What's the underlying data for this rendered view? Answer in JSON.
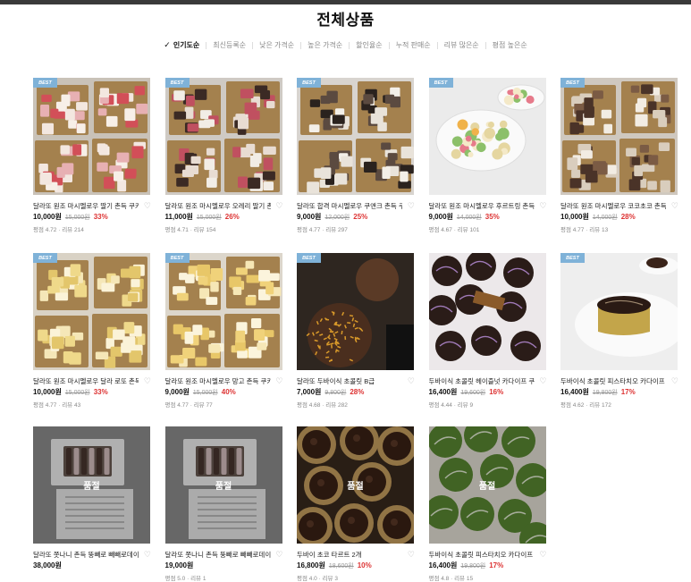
{
  "page_title": "전체상품",
  "sort_options": [
    {
      "label": "인기도순",
      "active": true
    },
    {
      "label": "최신등록순",
      "active": false
    },
    {
      "label": "낮은 가격순",
      "active": false
    },
    {
      "label": "높은 가격순",
      "active": false
    },
    {
      "label": "할인율순",
      "active": false
    },
    {
      "label": "누적 판매순",
      "active": false
    },
    {
      "label": "리뷰 많은순",
      "active": false
    },
    {
      "label": "평점 높은순",
      "active": false
    }
  ],
  "badge_best": "BEST",
  "soldout_label": "품절",
  "products": [
    {
      "name": "달라또 원조 마시멜로우 딸기 촌득 쿠키",
      "price": "10,000원",
      "orig": "15,000원",
      "disc": "33%",
      "rating": "평점 4.72 · 리뷰 214",
      "best": true,
      "img": "box-pink",
      "soldout": false
    },
    {
      "name": "달라또 원조 마시멜로우 오레리 딸기 촌득",
      "price": "11,000원",
      "orig": "15,000원",
      "disc": "26%",
      "rating": "평점 4.71 · 리뷰 154",
      "best": true,
      "img": "box-dark",
      "soldout": false
    },
    {
      "name": "달라또 합격 마시멜로우 쿠앤크 촌득 쿠키",
      "price": "9,000원",
      "orig": "12,000원",
      "disc": "25%",
      "rating": "평점 4.77 · 리뷰 297",
      "best": true,
      "img": "box-cookie",
      "soldout": false
    },
    {
      "name": "달라또 원조 마시멜로우 후르트링 촌득 쿠키",
      "price": "9,000원",
      "orig": "14,000원",
      "disc": "35%",
      "rating": "평점 4.67 · 리뷰 101",
      "best": true,
      "img": "plate",
      "soldout": false
    },
    {
      "name": "달라또 원조 마시멜로우 코코초코 촌득 쿠키",
      "price": "10,000원",
      "orig": "14,000원",
      "disc": "28%",
      "rating": "평점 4.77 · 리뷰 13",
      "best": true,
      "img": "box-coco",
      "soldout": false
    },
    {
      "name": "달라또 원조 마시멜로우 달라 로또 촌득 쿠키",
      "price": "10,000원",
      "orig": "15,000원",
      "disc": "33%",
      "rating": "평점 4.77 · 리뷰 43",
      "best": true,
      "img": "box-yellow",
      "soldout": false
    },
    {
      "name": "달라또 원조 마시멜로우 망고 촌득 쿠키",
      "price": "9,000원",
      "orig": "15,000원",
      "disc": "40%",
      "rating": "평점 4.77 · 리뷰 77",
      "best": true,
      "img": "box-yellow2",
      "soldout": false
    },
    {
      "name": "달라또 두바이식 초콜릿 B급",
      "price": "7,000원",
      "orig": "9,800원",
      "disc": "28%",
      "rating": "평점 4.68 · 리뷰 282",
      "best": true,
      "img": "choco-hand",
      "soldout": false
    },
    {
      "name": "두바이식 초콜릿 헤이즐넛 카다이프 쿠키",
      "price": "16,400원",
      "orig": "19,600원",
      "disc": "16%",
      "rating": "평점 4.44 · 리뷰 9",
      "best": false,
      "img": "choco-balls",
      "soldout": false
    },
    {
      "name": "두바이식 초콜릿 피스타치오 카다이프 쿠키",
      "price": "16,400원",
      "orig": "19,800원",
      "disc": "17%",
      "rating": "평점 4.62 · 리뷰 172",
      "best": true,
      "img": "choco-plate",
      "soldout": false
    },
    {
      "name": "달라또 쫏나니 촌득 뚱빼로 빼빼로데이 선물",
      "price": "38,000원",
      "orig": "",
      "disc": "",
      "rating": "",
      "best": false,
      "img": "gift",
      "soldout": true
    },
    {
      "name": "달라또 쫏나니 촌득 뚱빼로 빼빼로데이 선물",
      "price": "19,000원",
      "orig": "",
      "disc": "",
      "rating": "평점 5.0 · 리뷰 1",
      "best": false,
      "img": "gift2",
      "soldout": true
    },
    {
      "name": "두바이 초코 타르트 2개",
      "price": "16,800원",
      "orig": "18,600원",
      "disc": "10%",
      "rating": "평점 4.0 · 리뷰 3",
      "best": false,
      "img": "tart",
      "soldout": true
    },
    {
      "name": "두바이식 초콜릿 피스타치오 카다이프 쿠키",
      "price": "16,400원",
      "orig": "19,800원",
      "disc": "17%",
      "rating": "평점 4.8 · 리뷰 15",
      "best": false,
      "img": "green",
      "soldout": true
    }
  ]
}
